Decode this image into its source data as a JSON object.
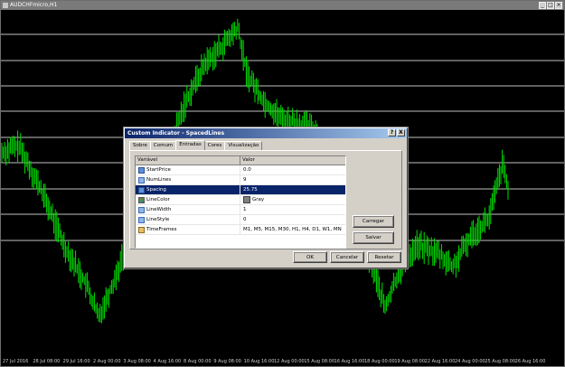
{
  "chart_window": {
    "title": "AUDCHFmicro,H1",
    "buttons": [
      "_",
      "□",
      "×"
    ]
  },
  "chart_data": {
    "type": "line",
    "line_color": "#00e000",
    "grid_line_color": "#bfbfbf",
    "x_labels": [
      "27 Jul 2016",
      "28 Jul 08:00",
      "29 Jul 16:00",
      "2 Aug 00:00",
      "3 Aug 08:00",
      "4 Aug 16:00",
      "8 Aug 00:00",
      "9 Aug 08:00",
      "10 Aug 16:00",
      "12 Aug 00:00",
      "15 Aug 08:00",
      "16 Aug 16:00",
      "18 Aug 00:00",
      "19 Aug 08:00",
      "22 Aug 16:00",
      "24 Aug 00:00",
      "25 Aug 08:00",
      "26 Aug 16:00"
    ]
  },
  "dialog": {
    "title": "Custom Indicator - SpacedLines",
    "help": "?",
    "close": "X",
    "tabs": [
      "Sobre",
      "Comum",
      "Entradas",
      "Cores",
      "Visualização"
    ],
    "active_tab": "Entradas",
    "columns": [
      "Variável",
      "Valor"
    ],
    "rows": [
      {
        "name": "StartPrice",
        "value": "0.0",
        "icon": "double-type-icon"
      },
      {
        "name": "NumLines",
        "value": "9",
        "icon": "integer-type-icon"
      },
      {
        "name": "Spacing",
        "value": "25.75",
        "icon": "double-type-icon",
        "selected": true
      },
      {
        "name": "LineColor",
        "value": "Gray",
        "icon": "color-type-icon"
      },
      {
        "name": "LineWidth",
        "value": "1",
        "icon": "integer-type-icon"
      },
      {
        "name": "LineStyle",
        "value": "0",
        "icon": "integer-type-icon"
      },
      {
        "name": "TimeFrames",
        "value": "M1, M5, M15, M30, H1, H4, D1, W1, MN",
        "icon": "string-type-icon"
      }
    ],
    "buttons": {
      "load": "Carregar",
      "save": "Salvar",
      "ok": "OK",
      "cancel": "Cancelar",
      "reset": "Resetar"
    }
  }
}
